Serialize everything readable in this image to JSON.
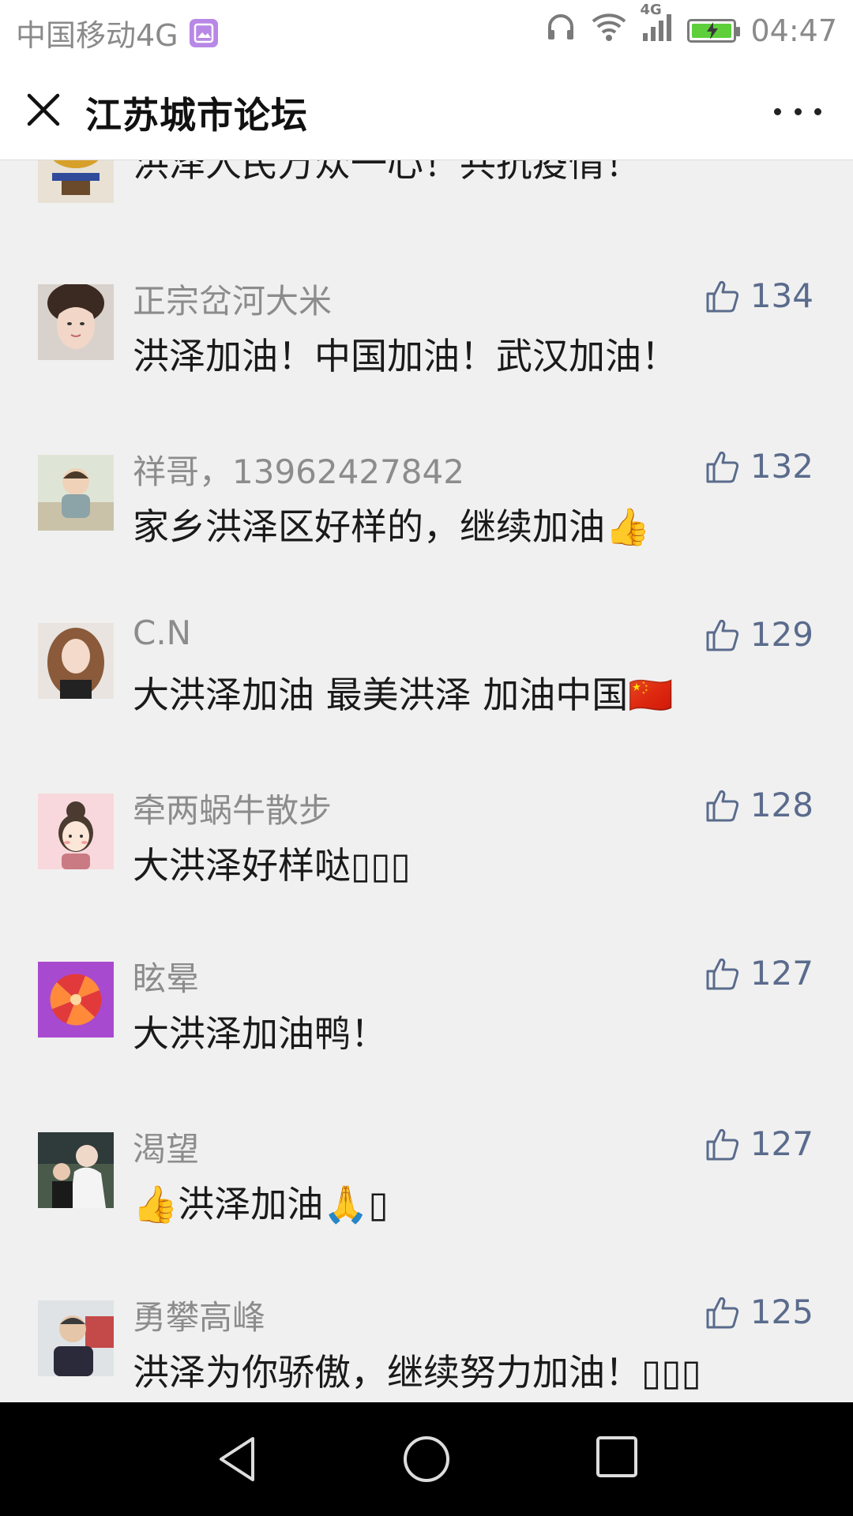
{
  "status": {
    "carrier": "中国移动4G",
    "network_badge": "4G",
    "time": "04:47"
  },
  "header": {
    "title": "江苏城市论坛"
  },
  "comments": [
    {
      "username": "",
      "text": "洪泽人民万众一心！共抗疫情！",
      "likes": ""
    },
    {
      "username": "正宗岔河大米",
      "text": "洪泽加油！中国加油！武汉加油！",
      "likes": "134"
    },
    {
      "username": "祥哥，13962427842",
      "text": "家乡洪泽区好样的，继续加油👍",
      "likes": "132"
    },
    {
      "username": "C.N",
      "text": "大洪泽加油 最美洪泽 加油中国🇨🇳",
      "likes": "129"
    },
    {
      "username": "牵两蜗牛散步",
      "text": "大洪泽好样哒▯▯▯",
      "likes": "128"
    },
    {
      "username": "眩晕",
      "text": "大洪泽加油鸭！",
      "likes": "127"
    },
    {
      "username": "渴望",
      "text": "👍洪泽加油🙏▯",
      "likes": "127"
    },
    {
      "username": "勇攀高峰",
      "text": "洪泽为你骄傲，继续努力加油！▯▯▯",
      "likes": "125"
    }
  ],
  "colors": {
    "like_blue": "#5a6b8c",
    "battery_green": "#5ccf3b",
    "badge_purple": "#b888e6"
  }
}
